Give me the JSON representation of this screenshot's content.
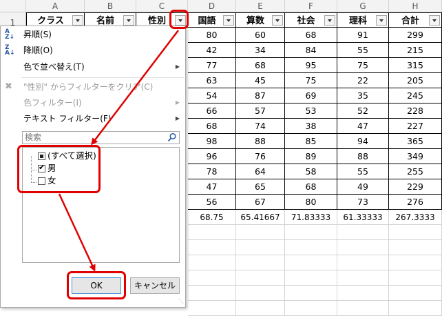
{
  "columns": [
    "A",
    "B",
    "C",
    "D",
    "E",
    "F",
    "G",
    "H"
  ],
  "row_numbers": [
    "1"
  ],
  "table": {
    "headers": [
      "クラス",
      "名前",
      "性別",
      "国語",
      "算数",
      "社会",
      "理科",
      "合計"
    ],
    "rows": [
      [
        "80",
        "60",
        "68",
        "91",
        "299"
      ],
      [
        "42",
        "34",
        "84",
        "55",
        "215"
      ],
      [
        "77",
        "68",
        "95",
        "75",
        "315"
      ],
      [
        "63",
        "45",
        "75",
        "22",
        "205"
      ],
      [
        "54",
        "87",
        "69",
        "35",
        "245"
      ],
      [
        "66",
        "57",
        "53",
        "52",
        "228"
      ],
      [
        "68",
        "74",
        "38",
        "47",
        "227"
      ],
      [
        "98",
        "88",
        "85",
        "94",
        "365"
      ],
      [
        "96",
        "76",
        "89",
        "88",
        "349"
      ],
      [
        "78",
        "64",
        "58",
        "55",
        "255"
      ],
      [
        "47",
        "65",
        "68",
        "49",
        "229"
      ],
      [
        "56",
        "67",
        "80",
        "73",
        "276"
      ]
    ],
    "averages": [
      "68.75",
      "65.41667",
      "71.83333",
      "61.33333",
      "267.3333"
    ]
  },
  "menu": {
    "sort_asc": "昇順(S)",
    "sort_desc": "降順(O)",
    "sort_color": "色で並べ替え(T)",
    "clear_filter": "\"性別\" からフィルターをクリア(C)",
    "color_filter": "色フィルター(I)",
    "text_filter": "テキスト フィルター(F)"
  },
  "search": {
    "placeholder": "検索"
  },
  "filter_list": {
    "select_all": "(すべて選択)",
    "items": [
      "男",
      "女"
    ],
    "checked": [
      true,
      false
    ]
  },
  "buttons": {
    "ok": "OK",
    "cancel": "キャンセル"
  },
  "colors": {
    "highlight": "#e00000",
    "grid": "#d4d4d4",
    "header_bg": "#f3f3f3"
  }
}
